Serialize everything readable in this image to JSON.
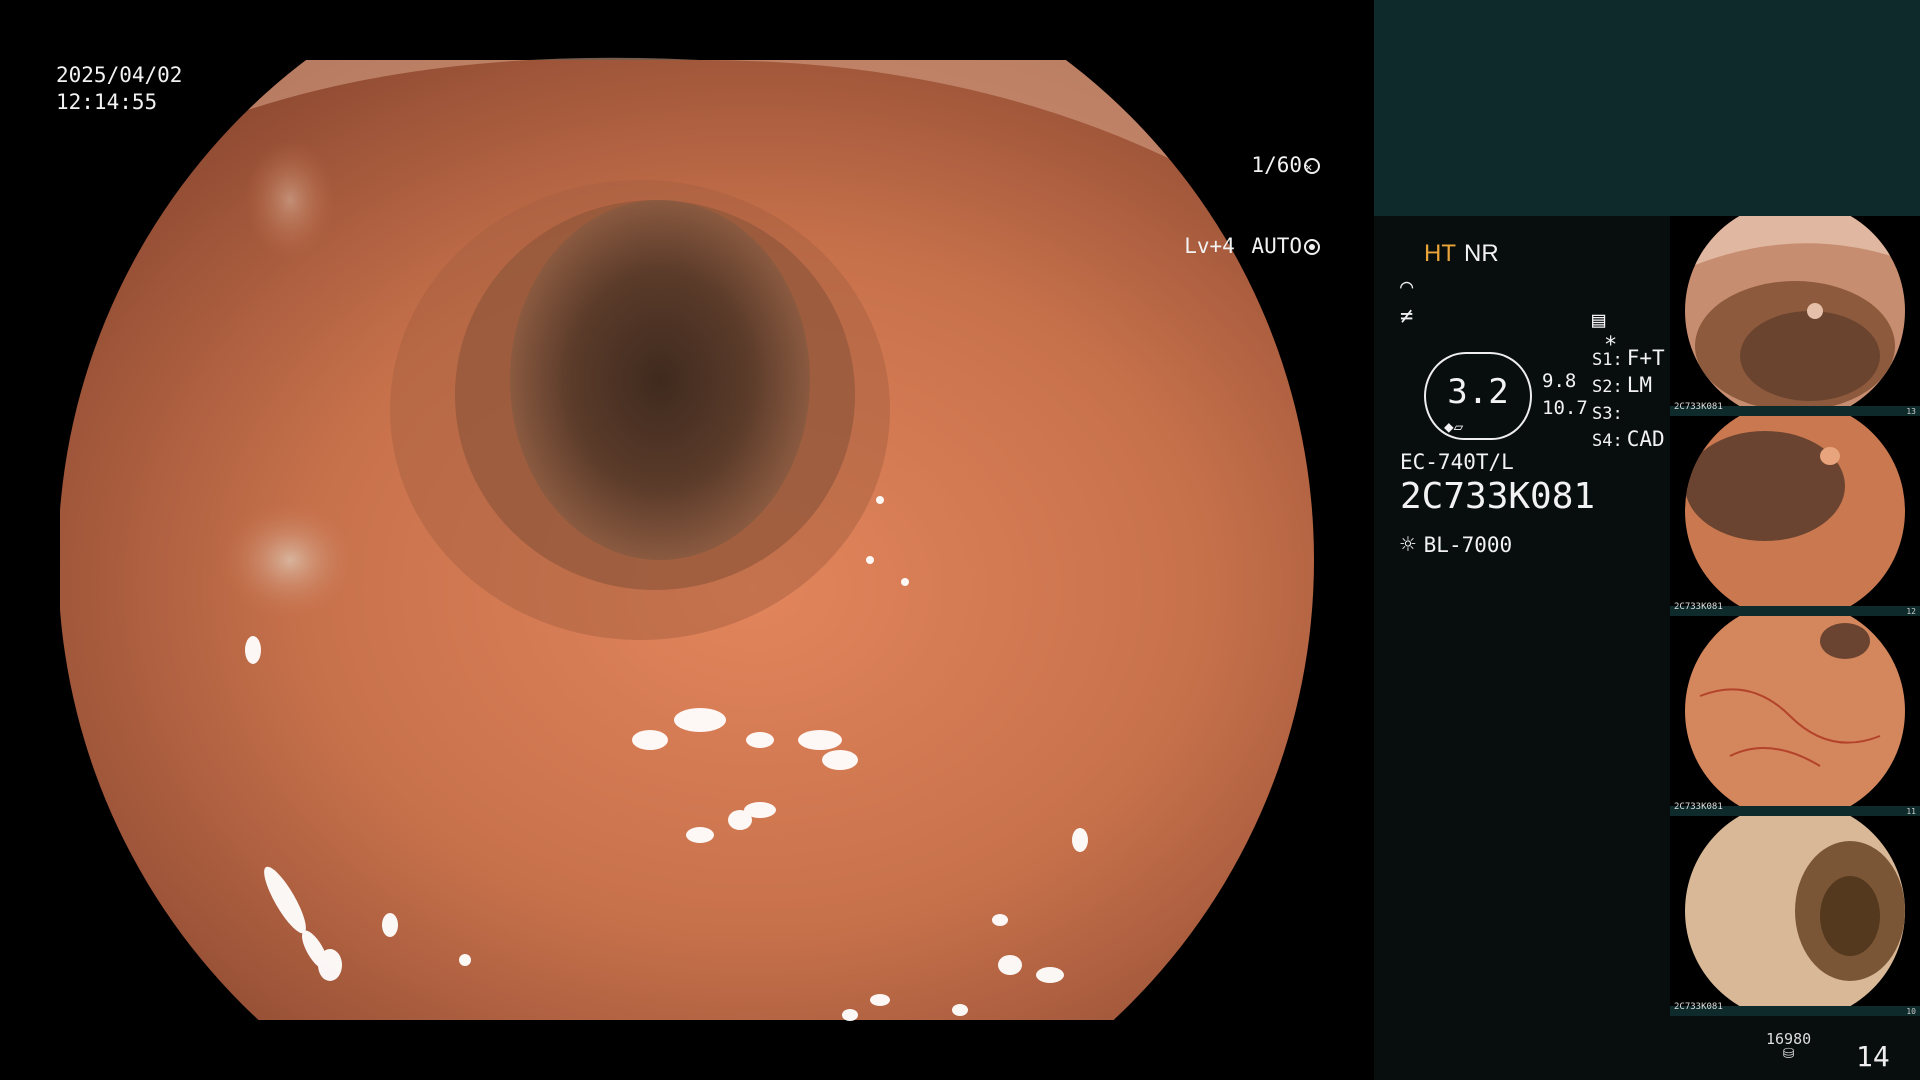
{
  "overlay": {
    "date": "2025/04/02",
    "time": "12:14:55",
    "shutter": "1/60",
    "level": "Lv+4",
    "iris": "AUTO"
  },
  "status": {
    "mode_ht": "HT",
    "mode_nr": "NR",
    "gauge_value": "3.2",
    "gauge_right_top": "9.8",
    "gauge_right_bottom": "10.7",
    "settings": [
      {
        "key": "S1:",
        "value": "F+T"
      },
      {
        "key": "S2:",
        "value": "LM"
      },
      {
        "key": "S3:",
        "value": ""
      },
      {
        "key": "S4:",
        "value": "CAD"
      }
    ],
    "asterisk": "*",
    "scope_model": "EC-740T/L",
    "scope_serial": "2C733K081",
    "light_source": "BL-7000"
  },
  "thumbnails": [
    {
      "caption": "2C733K081",
      "index": "13"
    },
    {
      "caption": "2C733K081",
      "index": "12"
    },
    {
      "caption": "2C733K081",
      "index": "11"
    },
    {
      "caption": "2C733K081",
      "index": "10"
    }
  ],
  "footer": {
    "count": "16980",
    "page": "14"
  },
  "colors": {
    "panel_top": "#0e2a2a",
    "panel": "#080d0d",
    "accent_ht": "#e9a53a",
    "mucosa": "#c7714b"
  },
  "icons": [
    "shutter-ring-icon",
    "iris-ring-icon",
    "wave-icon",
    "stepped-line-icon",
    "settings-list-icon",
    "light-source-icon",
    "disk-stack-icon"
  ]
}
